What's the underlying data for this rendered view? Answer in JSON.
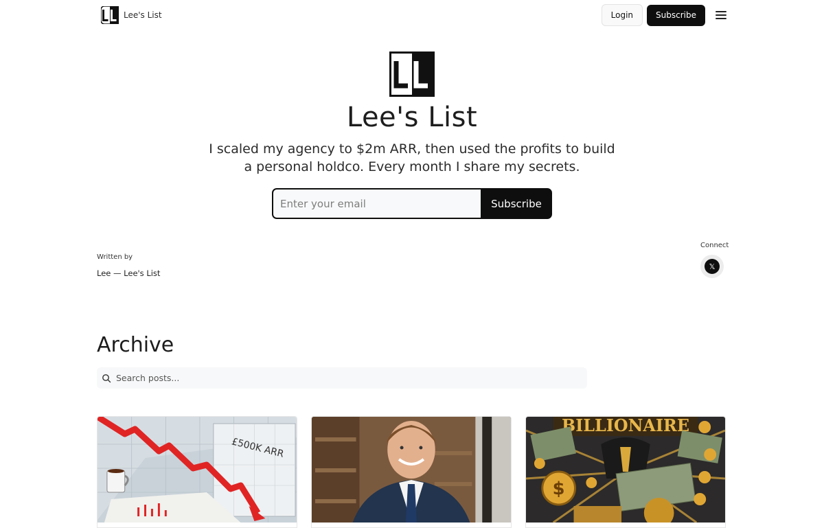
{
  "nav": {
    "brand_name": "Lee's List",
    "login_label": "Login",
    "subscribe_label": "Subscribe",
    "menu_icon": "hamburger-menu-icon"
  },
  "hero": {
    "title": "Lee's List",
    "tagline": "I scaled my agency to $2m ARR, then used the profits to build a personal holdco. Every month I share my secrets.",
    "email_placeholder": "Enter your email",
    "subscribe_label": "Subscribe"
  },
  "author": {
    "written_by_label": "Written by",
    "name": "Lee — Lee's List"
  },
  "connect": {
    "label": "Connect",
    "x_glyph": "𝕏",
    "icon": "x-social-icon"
  },
  "archive": {
    "title": "Archive",
    "search_placeholder": "Search posts...",
    "cards": [
      {
        "image": "declining-chart-illustration",
        "image_text": "£500K ARR"
      },
      {
        "image": "smiling-businessman-photo"
      },
      {
        "image": "billionaire-money-collage",
        "image_text": "BILLIONAIRE"
      }
    ]
  },
  "colors": {
    "primary_button": "#0e0e0e",
    "input_background": "#f8f9fa",
    "chart_arrow": "#e02424"
  }
}
